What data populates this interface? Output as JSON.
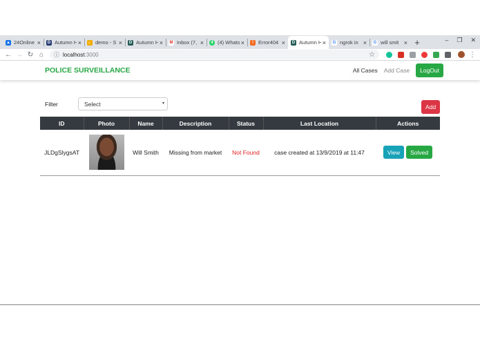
{
  "browser": {
    "tabs": [
      {
        "title": "24Online",
        "color": "#1a73e8",
        "icon": "mountain-icon"
      },
      {
        "title": "Autumn H",
        "color": "#243a73",
        "icon": "devpost-icon"
      },
      {
        "title": "demo - S",
        "color": "#f2a900",
        "icon": "hand-icon"
      },
      {
        "title": "Autumn H",
        "color": "#1f5a55",
        "icon": "devpost-icon"
      },
      {
        "title": "Inbox (7,",
        "color": "#d93025",
        "icon": "gmail-icon"
      },
      {
        "title": "(4) Whats",
        "color": "#25d366",
        "icon": "whatsapp-icon"
      },
      {
        "title": "Error404",
        "color": "#f26b21",
        "icon": "error-icon"
      },
      {
        "title": "Autumn H",
        "color": "#1f5a55",
        "icon": "devpost-icon"
      },
      {
        "title": "ngrok in",
        "color": "#4285f4",
        "icon": "google-icon"
      },
      {
        "title": "will smit",
        "color": "#4285f4",
        "icon": "google-icon"
      }
    ],
    "active_tab": 7,
    "new_tab": "+",
    "url_host": "localhost",
    "url_port": ":3000"
  },
  "app": {
    "brand": "POLICE SURVEILLANCE",
    "nav": {
      "all_cases": "All Cases",
      "add_case": "Add Case",
      "logout": "LogOut"
    },
    "filter": {
      "label": "Filter",
      "select_value": "Select",
      "add_label": "Add"
    },
    "table": {
      "headers": [
        "ID",
        "Photo",
        "Name",
        "Description",
        "Status",
        "Last Location",
        "Actions"
      ],
      "rows": [
        {
          "id": "JLDgSlygsAT",
          "name": "Will Smith",
          "description": "Missing from market",
          "status": "Not Found",
          "last_location": "case created at 13/9/2019 at 11:47",
          "view_label": "View",
          "solved_label": "Solved"
        }
      ]
    }
  },
  "colors": {
    "brand_green": "#28a745",
    "danger_red": "#dc3545",
    "info_blue": "#17a2b8",
    "header_dark": "#343a40",
    "status_red": "#e02020"
  }
}
